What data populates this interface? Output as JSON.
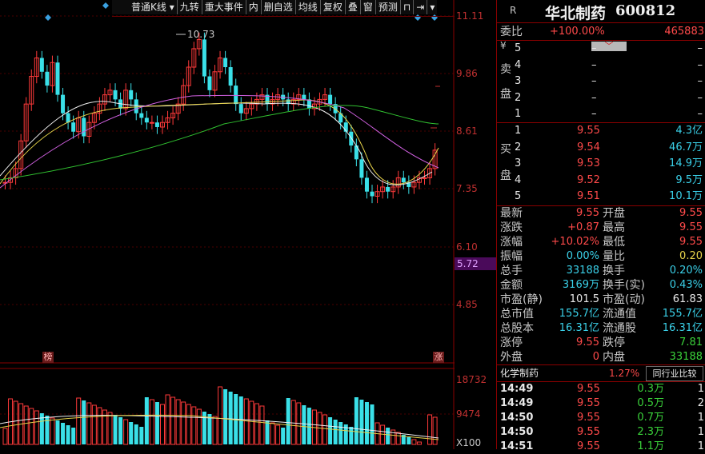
{
  "toolbar": {
    "items": [
      "普通K线",
      "九转",
      "重大事件",
      "内",
      "删自选",
      "均线",
      "复权",
      "叠",
      "窗",
      "预测"
    ]
  },
  "chart": {
    "price_ticks": [
      "11.11",
      "9.86",
      "8.61",
      "7.35",
      "6.10",
      "4.85"
    ],
    "current_price_label": "5.72",
    "high_marker": "10.73",
    "bang_marker": "榜",
    "zhang_marker": "涨",
    "volume_ticks": [
      "18732",
      "9474"
    ],
    "volume_unit": "X100"
  },
  "header": {
    "r_label": "R",
    "stock_name": "华北制药",
    "stock_code": "600812"
  },
  "weibi": {
    "label": "委比",
    "percent": "+100.00%",
    "value": "465883"
  },
  "sell": {
    "labels": [
      "¥",
      "卖",
      "盘"
    ],
    "rows": [
      {
        "level": "5",
        "price": "–",
        "vol": "–"
      },
      {
        "level": "4",
        "price": "–",
        "vol": "–"
      },
      {
        "level": "3",
        "price": "–",
        "vol": "–"
      },
      {
        "level": "2",
        "price": "–",
        "vol": "–"
      },
      {
        "level": "1",
        "price": "–",
        "vol": "–"
      }
    ]
  },
  "buy": {
    "labels": [
      "买",
      "盘"
    ],
    "rows": [
      {
        "level": "1",
        "price": "9.55",
        "vol": "4.3亿"
      },
      {
        "level": "2",
        "price": "9.54",
        "vol": "46.7万"
      },
      {
        "level": "3",
        "price": "9.53",
        "vol": "14.9万"
      },
      {
        "level": "4",
        "price": "9.52",
        "vol": "9.5万"
      },
      {
        "level": "5",
        "price": "9.51",
        "vol": "10.1万"
      }
    ]
  },
  "stats": [
    {
      "l1": "最新",
      "v1": "9.55",
      "c1": "red",
      "l2": "开盘",
      "v2": "9.55",
      "c2": "red"
    },
    {
      "l1": "涨跌",
      "v1": "+0.87",
      "c1": "red",
      "l2": "最高",
      "v2": "9.55",
      "c2": "red"
    },
    {
      "l1": "涨幅",
      "v1": "+10.02%",
      "c1": "red",
      "l2": "最低",
      "v2": "9.55",
      "c2": "red"
    },
    {
      "l1": "振幅",
      "v1": "0.00%",
      "c1": "cyan",
      "l2": "量比",
      "v2": "0.20",
      "c2": "yellow"
    },
    {
      "l1": "总手",
      "v1": "33188",
      "c1": "cyan",
      "l2": "换手",
      "v2": "0.20%",
      "c2": "cyan"
    },
    {
      "l1": "金额",
      "v1": "3169万",
      "c1": "cyan",
      "l2": "换手(实)",
      "v2": "0.43%",
      "c2": "cyan"
    },
    {
      "l1": "市盈(静)",
      "v1": "101.5",
      "c1": "white",
      "l2": "市盈(动)",
      "v2": "61.83",
      "c2": "white"
    },
    {
      "l1": "总市值",
      "v1": "155.7亿",
      "c1": "cyan",
      "l2": "流通值",
      "v2": "155.7亿",
      "c2": "cyan"
    },
    {
      "l1": "总股本",
      "v1": "16.31亿",
      "c1": "cyan",
      "l2": "流通股",
      "v2": "16.31亿",
      "c2": "cyan"
    },
    {
      "l1": "涨停",
      "v1": "9.55",
      "c1": "red",
      "l2": "跌停",
      "v2": "7.81",
      "c2": "green"
    },
    {
      "l1": "外盘",
      "v1": "0",
      "c1": "red",
      "l2": "内盘",
      "v2": "33188",
      "c2": "green"
    }
  ],
  "industry": {
    "name": "化学制药",
    "change": "1.27%",
    "compare_button": "同行业比较"
  },
  "ticks": [
    {
      "time": "14:49",
      "price": "9.55",
      "vol": "0.3万",
      "n": "1"
    },
    {
      "time": "14:49",
      "price": "9.55",
      "vol": "0.5万",
      "n": "2"
    },
    {
      "time": "14:50",
      "price": "9.55",
      "vol": "0.7万",
      "n": "1"
    },
    {
      "time": "14:50",
      "price": "9.55",
      "vol": "2.3万",
      "n": "1"
    },
    {
      "time": "14:51",
      "price": "9.55",
      "vol": "1.1万",
      "n": "1"
    }
  ]
}
